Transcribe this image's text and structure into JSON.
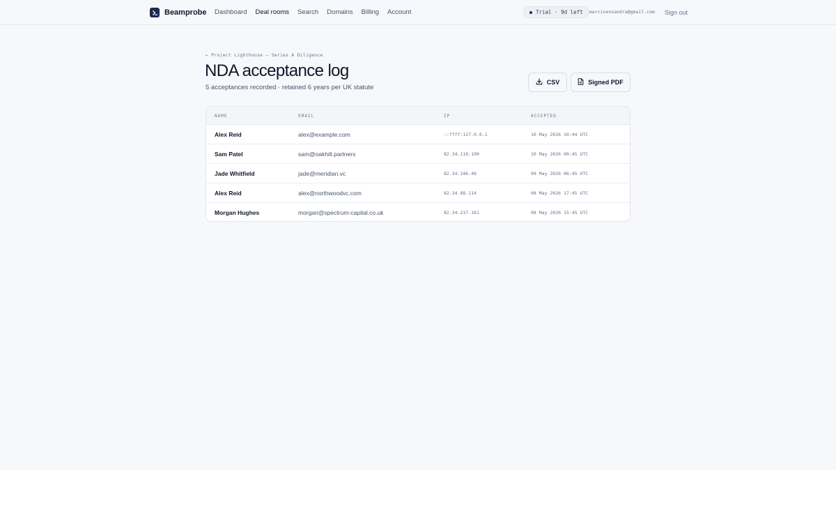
{
  "brand": {
    "name": "Beamprobe"
  },
  "nav": {
    "items": [
      {
        "label": "Dashboard"
      },
      {
        "label": "Deal rooms"
      },
      {
        "label": "Search"
      },
      {
        "label": "Domains"
      },
      {
        "label": "Billing"
      },
      {
        "label": "Account"
      }
    ],
    "active": "Deal rooms"
  },
  "account": {
    "trial": "Trial · 9d left",
    "email": "marcinensandra@gmail.com",
    "signout": "Sign out"
  },
  "page": {
    "breadcrumb": "← Project Lighthouse — Series A Diligence",
    "title": "NDA acceptance log",
    "subtitle": "5 acceptances recorded · retained 6 years per UK statute"
  },
  "actions": {
    "csv": "CSV",
    "pdf": "Signed PDF"
  },
  "table": {
    "headers": {
      "name": "NAME",
      "email": "EMAIL",
      "ip": "IP",
      "accepted": "ACCEPTED"
    },
    "rows": [
      {
        "name": "Alex Reid",
        "email": "alex@example.com",
        "ip": "::ffff:127.0.0.1",
        "accepted": "10 May 2026 10:44 UTC"
      },
      {
        "name": "Sam Patel",
        "email": "sam@oakhill.partners",
        "ip": "82.34.110.190",
        "accepted": "10 May 2026 00:45 UTC"
      },
      {
        "name": "Jade Whitfield",
        "email": "jade@meridian.vc",
        "ip": "82.34.246.48",
        "accepted": "09 May 2026 06:45 UTC"
      },
      {
        "name": "Alex Reid",
        "email": "alex@northwoodvc.com",
        "ip": "82.34.88.114",
        "accepted": "08 May 2026 17:45 UTC"
      },
      {
        "name": "Morgan Hughes",
        "email": "morgan@spectrum-capital.co.uk",
        "ip": "82.34.237.161",
        "accepted": "08 May 2026 15:45 UTC"
      }
    ]
  },
  "icons": {
    "logo": "terminal-prompt-icon",
    "csv": "download-icon",
    "pdf": "document-icon"
  },
  "colors": {
    "brand": "#1e2a4f",
    "background": "#f7f8fb"
  }
}
